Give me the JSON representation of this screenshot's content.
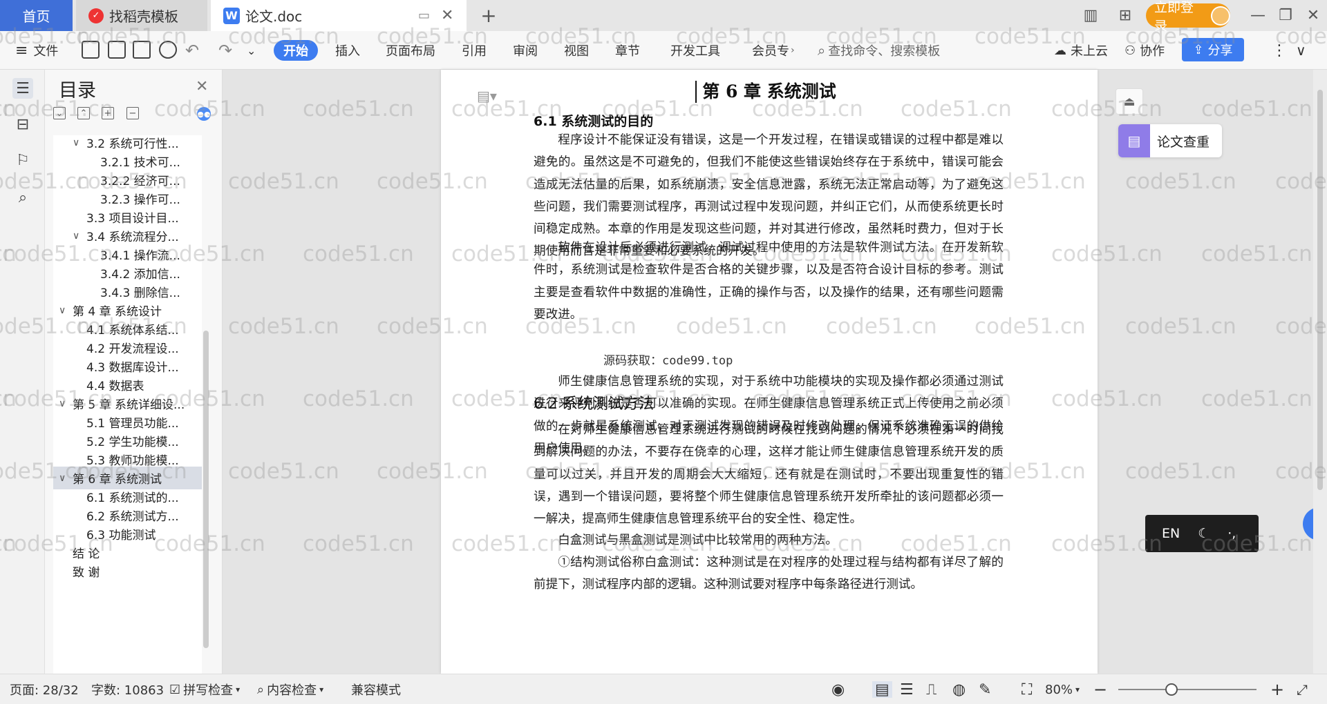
{
  "tabs": {
    "home": "首页",
    "daoke": "找稻壳模板",
    "doc": "论文.doc",
    "login": "立即登录"
  },
  "menu": {
    "file": "文件",
    "start": "开始",
    "insert": "插入",
    "layout": "页面布局",
    "ref": "引用",
    "review": "审阅",
    "view": "视图",
    "chapter": "章节",
    "dev": "开发工具",
    "member": "会员专",
    "search_placeholder": "查找命令、搜索模板",
    "cloud": "未上云",
    "collab": "协作",
    "share": "分享"
  },
  "toc": {
    "title": "目录",
    "items": [
      {
        "label": "3.2 系统可行性...",
        "level": 1,
        "expand": "∨"
      },
      {
        "label": "3.2.1 技术可...",
        "level": 2
      },
      {
        "label": "3.2.2 经济可...",
        "level": 2
      },
      {
        "label": "3.2.3 操作可...",
        "level": 2
      },
      {
        "label": "3.3 项目设计目...",
        "level": 1
      },
      {
        "label": "3.4 系统流程分...",
        "level": 1,
        "expand": "∨"
      },
      {
        "label": "3.4.1 操作流...",
        "level": 2
      },
      {
        "label": "3.4.2 添加信...",
        "level": 2
      },
      {
        "label": "3.4.3 删除信...",
        "level": 2
      },
      {
        "label": "第 4 章  系统设计",
        "level": 0,
        "expand": "∨"
      },
      {
        "label": "4.1  系统体系结...",
        "level": 1
      },
      {
        "label": "4.2 开发流程设...",
        "level": 1
      },
      {
        "label": "4.3  数据库设计...",
        "level": 1
      },
      {
        "label": "4.4  数据表",
        "level": 1
      },
      {
        "label": "第 5 章  系统详细设...",
        "level": 0,
        "expand": "∨"
      },
      {
        "label": "5.1 管理员功能...",
        "level": 1
      },
      {
        "label": "5.2 学生功能模...",
        "level": 1
      },
      {
        "label": "5.3 教师功能模...",
        "level": 1
      },
      {
        "label": "第 6 章    系统测试",
        "level": 0,
        "expand": "∨",
        "selected": true
      },
      {
        "label": "6.1 系统测试的...",
        "level": 1
      },
      {
        "label": "6.2 系统测试方...",
        "level": 1
      },
      {
        "label": "6.3 功能测试",
        "level": 1
      },
      {
        "label": "结  论",
        "level": 0
      },
      {
        "label": "致  谢",
        "level": 0
      }
    ]
  },
  "doc": {
    "chapter": "第 6 章    系统测试",
    "h1": "6.1 系统测试的目的",
    "p1": "程序设计不能保证没有错误，这是一个开发过程，在错误或错误的过程中都是难以避免的。虽然这是不可避免的，但我们不能使这些错误始终存在于系统中，错误可能会造成无法估量的后果，如系统崩溃，安全信息泄露，系统无法正常启动等，为了避免这些问题，我们需要测试程序，再测试过程中发现问题，并纠正它们，从而使系统更长时间稳定成熟。本章的作用是发现这些问题，并对其进行修改，虽然耗时费力，但对于长期使用而言是非常重要和必要系统的开发。",
    "p2": "软件在设计后必须进行测试，调试过程中使用的方法是软件测试方法。在开发新软件时，系统测试是检查软件是否合格的关键步骤，以及是否符合设计目标的参考。测试主要是查看软件中数据的准确性，正确的操作与否，以及操作的结果，还有哪些问题需要改进。",
    "src": "源码获取：code99.top",
    "p3": "师生健康信息管理系统的实现，对于系统中功能模块的实现及操作都必须通过测试进行来评判系统是否可以准确的实现。在师生健康信息管理系统正式上传使用之前必须做的一步就是系统测试，对于测试发现的错误及时修改处理，保证系统准确无误的供给用户使用。",
    "h2": "6.2 系统测试方法",
    "p4": "在对师生健康信息管理系统进行测试的时候在找到问题的情况下必须在第一时间找到解决问题的办法，不要存在侥幸的心理，这样才能让师生健康信息管理系统开发的质量可以过关，并且开发的周期会大大缩短，还有就是在测试时，不要出现重复性的错误，遇到一个错误问题，要将整个师生健康信息管理系统开发所牵扯的该问题都必须一一解决，提高师生健康信息管理系统平台的安全性、稳定性。",
    "p5": "白盒测试与黑盒测试是测试中比较常用的两种方法。",
    "p6": "①结构测试俗称白盒测试：这种测试是在对程序的处理过程与结构都有详尽了解的前提下，测试程序内部的逻辑。这种测试要对程序中每条路径进行测试。"
  },
  "side": {
    "lunwen": "论文查重",
    "ime": "EN",
    "ime2": "·,"
  },
  "status": {
    "page": "页面: 28/32",
    "words": "字数: 10863",
    "spell": "拼写检查",
    "content": "内容检查",
    "compat": "兼容模式",
    "zoom": "80%"
  },
  "watermark": "code51.cn",
  "colors": {
    "accent": "#3d7cf0",
    "login": "#f29b16"
  }
}
